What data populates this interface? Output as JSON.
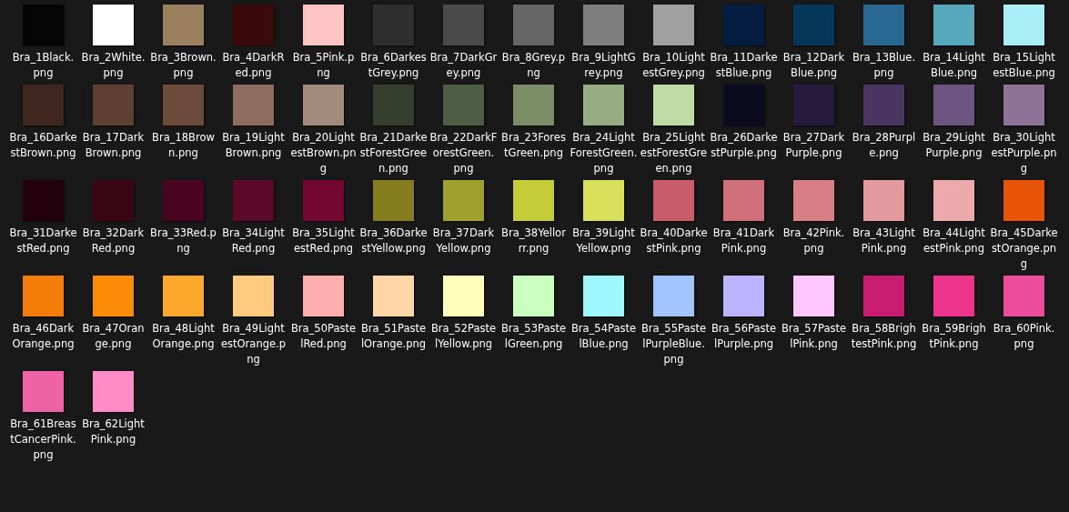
{
  "files": [
    {
      "name": "Bra_1Black.png",
      "color": "#050505"
    },
    {
      "name": "Bra_2White.png",
      "color": "#ffffff"
    },
    {
      "name": "Bra_3Brown.png",
      "color": "#9b8060"
    },
    {
      "name": "Bra_4DarkRed.png",
      "color": "#3a0a0b"
    },
    {
      "name": "Bra_5Pink.png",
      "color": "#ffc5c5"
    },
    {
      "name": "Bra_6DarkestGrey.png",
      "color": "#2e2e2e"
    },
    {
      "name": "Bra_7DarkGrey.png",
      "color": "#4a4a4a"
    },
    {
      "name": "Bra_8Grey.png",
      "color": "#666666"
    },
    {
      "name": "Bra_9LightGrey.png",
      "color": "#7f7f7f"
    },
    {
      "name": "Bra_10LightestGrey.png",
      "color": "#a0a0a0"
    },
    {
      "name": "Bra_11DarkestBlue.png",
      "color": "#041c40"
    },
    {
      "name": "Bra_12DarkBlue.png",
      "color": "#053858"
    },
    {
      "name": "Bra_13Blue.png",
      "color": "#286890"
    },
    {
      "name": "Bra_14LightBlue.png",
      "color": "#56a8bc"
    },
    {
      "name": "Bra_15LightestBlue.png",
      "color": "#a8eef4"
    },
    {
      "name": "Bra_16DarkestBrown.png",
      "color": "#3f2720"
    },
    {
      "name": "Bra_17DarkBrown.png",
      "color": "#5e4032"
    },
    {
      "name": "Bra_18Brown.png",
      "color": "#6d4b3b"
    },
    {
      "name": "Bra_19LightBrown.png",
      "color": "#8d6e5e"
    },
    {
      "name": "Bra_20LightestBrown.png",
      "color": "#a28a7c"
    },
    {
      "name": "Bra_21DarkestForestGreen.png",
      "color": "#363f2e"
    },
    {
      "name": "Bra_22DarkForestGreen.png",
      "color": "#4e5e44"
    },
    {
      "name": "Bra_23ForestGreen.png",
      "color": "#7a8d66"
    },
    {
      "name": "Bra_24LightForestGreen.png",
      "color": "#96ac82"
    },
    {
      "name": "Bra_25LightestForestGreen.png",
      "color": "#bfdca6"
    },
    {
      "name": "Bra_26DarkestPurple.png",
      "color": "#0c0a1e"
    },
    {
      "name": "Bra_27DarkPurple.png",
      "color": "#281a3c"
    },
    {
      "name": "Bra_28Purple.png",
      "color": "#4a3462"
    },
    {
      "name": "Bra_29LightPurple.png",
      "color": "#6e5480"
    },
    {
      "name": "Bra_30LightestPurple.png",
      "color": "#8e7298"
    },
    {
      "name": "Bra_31DarkestRed.png",
      "color": "#22000c"
    },
    {
      "name": "Bra_32DarkRed.png",
      "color": "#3a0616"
    },
    {
      "name": "Bra_33Red.png",
      "color": "#4a0620"
    },
    {
      "name": "Bra_34LightRed.png",
      "color": "#5c0828"
    },
    {
      "name": "Bra_35LightestRed.png",
      "color": "#720830"
    },
    {
      "name": "Bra_36DarkestYellow.png",
      "color": "#857c20"
    },
    {
      "name": "Bra_37DarkYellow.png",
      "color": "#a0a02c"
    },
    {
      "name": "Bra_38Yellorrr.png",
      "color": "#c4cc38"
    },
    {
      "name": "Bra_39LightYellow.png",
      "color": "#d8e05c"
    },
    {
      "name": "Bra_40DarkestPink.png",
      "color": "#c85c6a"
    },
    {
      "name": "Bra_41DarkPink.png",
      "color": "#d0707a"
    },
    {
      "name": "Bra_42Pink.png",
      "color": "#d88086"
    },
    {
      "name": "Bra_43LightPink.png",
      "color": "#e29a9e"
    },
    {
      "name": "Bra_44LightestPink.png",
      "color": "#ecaaac"
    },
    {
      "name": "Bra_45DarkestOrange.png",
      "color": "#e85408"
    },
    {
      "name": "Bra_46DarkOrange.png",
      "color": "#f47c08"
    },
    {
      "name": "Bra_47Orange.png",
      "color": "#fc8c08"
    },
    {
      "name": "Bra_48LightOrange.png",
      "color": "#fca82c"
    },
    {
      "name": "Bra_49LightestOrange.png",
      "color": "#fecb80"
    },
    {
      "name": "Bra_50PastelRed.png",
      "color": "#ffaeae"
    },
    {
      "name": "Bra_51PastelOrange.png",
      "color": "#ffd6a8"
    },
    {
      "name": "Bra_52PastelYellow.png",
      "color": "#ffffbc"
    },
    {
      "name": "Bra_53PastelGreen.png",
      "color": "#cbffc0"
    },
    {
      "name": "Bra_54PastelBlue.png",
      "color": "#9ef6ff"
    },
    {
      "name": "Bra_55PastelPurpleBlue.png",
      "color": "#a2c4ff"
    },
    {
      "name": "Bra_56PastelPurple.png",
      "color": "#bdb4ff"
    },
    {
      "name": "Bra_57PastelPink.png",
      "color": "#ffc6ff"
    },
    {
      "name": "Bra_58BrightestPink.png",
      "color": "#c81c70"
    },
    {
      "name": "Bra_59BrightPink.png",
      "color": "#ec348c"
    },
    {
      "name": "Bra_60Pink.png",
      "color": "#ee4c9c"
    },
    {
      "name": "Bra_61BreastCancerPink.png",
      "color": "#ee62a6"
    },
    {
      "name": "Bra_62LightPink.png",
      "color": "#ff8cc6"
    }
  ]
}
